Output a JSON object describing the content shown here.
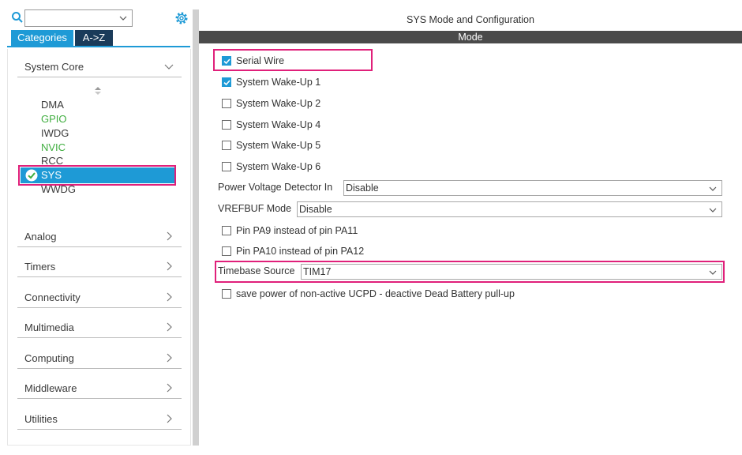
{
  "search": {
    "value": ""
  },
  "tabs": [
    {
      "label": "Categories",
      "active": true
    },
    {
      "label": "A->Z",
      "active": false
    }
  ],
  "categories": {
    "expanded": {
      "label": "System Core",
      "items": [
        {
          "label": "DMA",
          "state": "plain"
        },
        {
          "label": "GPIO",
          "state": "configured"
        },
        {
          "label": "IWDG",
          "state": "plain"
        },
        {
          "label": "NVIC",
          "state": "configured"
        },
        {
          "label": "RCC",
          "state": "plain"
        },
        {
          "label": "SYS",
          "state": "selected"
        },
        {
          "label": "WWDG",
          "state": "plain"
        }
      ]
    },
    "collapsed": [
      "Analog",
      "Timers",
      "Connectivity",
      "Multimedia",
      "Computing",
      "Middleware",
      "Utilities"
    ]
  },
  "panel": {
    "title": "SYS Mode and Configuration",
    "mode_header": "Mode"
  },
  "options": {
    "serial_wire": {
      "label": "Serial Wire",
      "checked": true
    },
    "wakeup1": {
      "label": "System Wake-Up 1",
      "checked": true
    },
    "wakeup2": {
      "label": "System Wake-Up 2",
      "checked": false
    },
    "wakeup4": {
      "label": "System Wake-Up 4",
      "checked": false
    },
    "wakeup5": {
      "label": "System Wake-Up 5",
      "checked": false
    },
    "wakeup6": {
      "label": "System Wake-Up 6",
      "checked": false
    },
    "pa9": {
      "label": "Pin PA9 instead of pin PA11",
      "checked": false
    },
    "pa10": {
      "label": "Pin PA10 instead of pin PA12",
      "checked": false
    },
    "ucpd": {
      "label": "save power of non-active UCPD - deactive Dead Battery pull-up",
      "checked": false
    }
  },
  "selects": {
    "pvd": {
      "label": "Power Voltage Detector In",
      "value": "Disable"
    },
    "vrefbuf": {
      "label": "VREFBUF Mode",
      "value": "Disable"
    },
    "timebase": {
      "label": "Timebase Source",
      "value": "TIM17"
    }
  },
  "colors": {
    "accent": "#1e9ad6",
    "highlight": "#e0207a",
    "configured": "#3fae3f",
    "mode_bar": "#4a4a4a"
  }
}
